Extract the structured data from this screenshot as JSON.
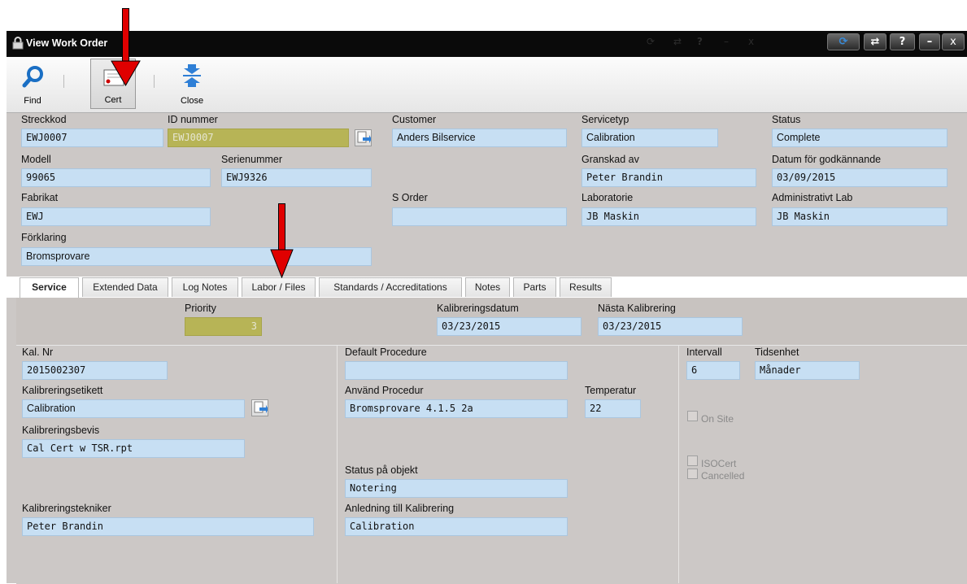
{
  "window": {
    "title": "View Work Order"
  },
  "titlebar_buttons": {
    "refresh": "⟳",
    "switch": "⇄",
    "help": "?",
    "minimize": "–",
    "close": "x"
  },
  "toolbar": {
    "find": "Find",
    "cert": "Cert",
    "close": "Close"
  },
  "header_fields": {
    "streckkod": {
      "label": "Streckkod",
      "value": "EWJ0007"
    },
    "id_nummer": {
      "label": "ID nummer",
      "value": "EWJ0007"
    },
    "customer": {
      "label": "Customer",
      "value": "Anders Bilservice"
    },
    "servicetyp": {
      "label": "Servicetyp",
      "value": "Calibration"
    },
    "status": {
      "label": "Status",
      "value": "Complete"
    },
    "modell": {
      "label": "Modell",
      "value": "99065"
    },
    "serienummer": {
      "label": "Serienummer",
      "value": "EWJ9326"
    },
    "granskad_av": {
      "label": "Granskad av",
      "value": "Peter Brandin"
    },
    "datum_godkannande": {
      "label": "Datum för godkännande",
      "value": "03/09/2015"
    },
    "fabrikat": {
      "label": "Fabrikat",
      "value": "EWJ"
    },
    "s_order": {
      "label": "S Order",
      "value": ""
    },
    "laboratorie": {
      "label": "Laboratorie",
      "value": "JB Maskin"
    },
    "administrativt_lab": {
      "label": "Administrativt Lab",
      "value": "JB Maskin"
    },
    "forklaring": {
      "label": "Förklaring",
      "value": "Bromsprovare"
    }
  },
  "tabs": [
    "Service",
    "Extended Data",
    "Log Notes",
    "Labor / Files",
    "Standards / Accreditations",
    "Notes",
    "Parts",
    "Results"
  ],
  "service": {
    "priority": {
      "label": "Priority",
      "value": "3"
    },
    "kalibreringsdatum": {
      "label": "Kalibreringsdatum",
      "value": "03/23/2015"
    },
    "nasta_kalibrering": {
      "label": "Nästa Kalibrering",
      "value": "03/23/2015"
    },
    "kal_nr": {
      "label": "Kal. Nr",
      "value": "2015002307"
    },
    "default_procedure": {
      "label": "Default Procedure",
      "value": ""
    },
    "intervall": {
      "label": "Intervall",
      "value": "6"
    },
    "tidsenhet": {
      "label": "Tidsenhet",
      "value": "Månader"
    },
    "kalibreringsetikett": {
      "label": "Kalibreringsetikett",
      "value": "Calibration"
    },
    "anvand_procedur": {
      "label": "Använd Procedur",
      "value": "Bromsprovare 4.1.5 2a"
    },
    "temperatur": {
      "label": "Temperatur",
      "value": "22"
    },
    "kalibreringsbevis": {
      "label": "Kalibreringsbevis",
      "value": "Cal Cert w TSR.rpt"
    },
    "on_site": {
      "label": "On Site",
      "checked": false
    },
    "isocert": {
      "label": "ISOCert",
      "checked": false
    },
    "cancelled": {
      "label": "Cancelled",
      "checked": false
    },
    "status_pa_objekt": {
      "label": "Status på objekt",
      "value": "Notering"
    },
    "kalibreringstekniker": {
      "label": "Kalibreringstekniker",
      "value": "Peter Brandin"
    },
    "anledning": {
      "label": "Anledning till Kalibrering",
      "value": "Calibration"
    }
  },
  "colors": {
    "field_bg": "#c7dff3",
    "readonly_bg": "#b7b456",
    "window_bg": "#ccc8c6",
    "arrow": "#e00000"
  }
}
